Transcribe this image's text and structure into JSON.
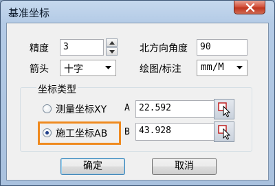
{
  "window": {
    "title": "基准坐标"
  },
  "precision": {
    "label": "精度",
    "value": "3"
  },
  "north_angle": {
    "label": "北方向角度",
    "value": "90"
  },
  "arrow": {
    "label": "箭头",
    "value": "十字"
  },
  "draw_unit": {
    "label": "绘图/标注",
    "value": "mm/M"
  },
  "coord_type": {
    "title": "坐标类型",
    "options": [
      {
        "label": "测量坐标XY",
        "selected": false
      },
      {
        "label": "施工坐标AB",
        "selected": true
      }
    ],
    "fields": [
      {
        "label": "A",
        "value": "22.592"
      },
      {
        "label": "B",
        "value": "43.928"
      }
    ]
  },
  "buttons": {
    "ok": "确定",
    "cancel": "取消"
  },
  "icons": {
    "close": "close-icon",
    "pick": "pick-point-icon",
    "spin_up": "up-arrow-icon",
    "spin_down": "down-arrow-icon"
  },
  "colors": {
    "highlight": "#ef8a1f",
    "close": "#c0361f"
  }
}
